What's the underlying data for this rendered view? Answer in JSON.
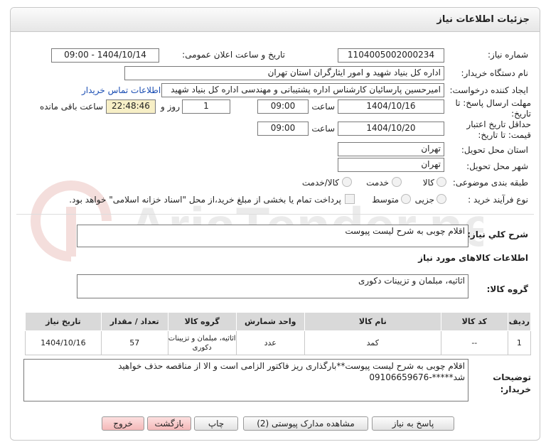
{
  "header": {
    "title": "جزئیات اطلاعات نیاز"
  },
  "need_number": {
    "label": "شماره نیاز:",
    "value": "1104005002000234"
  },
  "announce": {
    "label": "تاریخ و ساعت اعلان عمومی:",
    "value": "1404/10/14 - 09:00"
  },
  "buyer": {
    "label": "نام دستگاه خریدار:",
    "value": "اداره کل بنیاد شهید و امور ایثارگران استان تهران"
  },
  "requester": {
    "label": "ایجاد کننده درخواست:",
    "value": "امیرحسین پارسائیان کارشناس اداره پشتیبانی و مهندسی  اداره کل بنیاد شهید",
    "contact_link": "اطلاعات تماس خریدار"
  },
  "deadline": {
    "label": "مهلت ارسال پاسخ: تا تاریخ:",
    "date": "1404/10/16",
    "time_label": "ساعت",
    "time": "09:00",
    "days": "1",
    "days_label": "روز و",
    "remaining": "22:48:46",
    "remaining_label": "ساعت باقی مانده"
  },
  "validity": {
    "label": "حداقل تاریخ اعتبار قیمت: تا تاریخ:",
    "date": "1404/10/20",
    "time_label": "ساعت",
    "time": "09:00"
  },
  "province": {
    "label": "استان محل تحویل:",
    "value": "تهران"
  },
  "city": {
    "label": "شهر محل تحویل:",
    "value": "تهران"
  },
  "category": {
    "label": "طبقه بندی موضوعی:",
    "options": [
      "کالا",
      "خدمت",
      "کالا/خدمت"
    ]
  },
  "process": {
    "label": "نوع فرآیند خرید :",
    "options": [
      "جزیی",
      "متوسط"
    ],
    "payment_note": "پرداخت تمام یا بخشی از مبلغ خرید،از محل \"اسناد خزانه اسلامی\" خواهد بود."
  },
  "description": {
    "label": "شرح کلي نياز:",
    "value": "اقلام چوبی به شرح لیست پیوست"
  },
  "items_section": {
    "title": "اطلاعات کالاهای مورد نیاز"
  },
  "goods_group": {
    "label": "گروه کالا:",
    "value": "اثاثیه، مبلمان و تزیینات دکوری"
  },
  "table": {
    "headers": [
      "ردیف",
      "کد کالا",
      "نام کالا",
      "واحد شمارش",
      "گروه کالا",
      "تعداد / مقدار",
      "تاریخ نیاز"
    ],
    "rows": [
      [
        "1",
        "--",
        "کمد",
        "عدد",
        "اثاثیه، مبلمان و تزیینات دکوری",
        "57",
        "1404/10/16"
      ]
    ]
  },
  "buyer_notes": {
    "label": "توضیحات خریدار:",
    "value": "اقلام چوبی به شرح لیست پیوست**بارگذاری ریز فاکتور الزامی است و الا از مناقصه حذف خواهید شد*****-09106659676"
  },
  "buttons": {
    "reply": "پاسخ به نیاز",
    "docs": "مشاهده مدارک پیوستی (2)",
    "print": "چاپ",
    "back": "بازگشت",
    "exit": "خروج"
  },
  "watermark": "AriaTender.net"
}
